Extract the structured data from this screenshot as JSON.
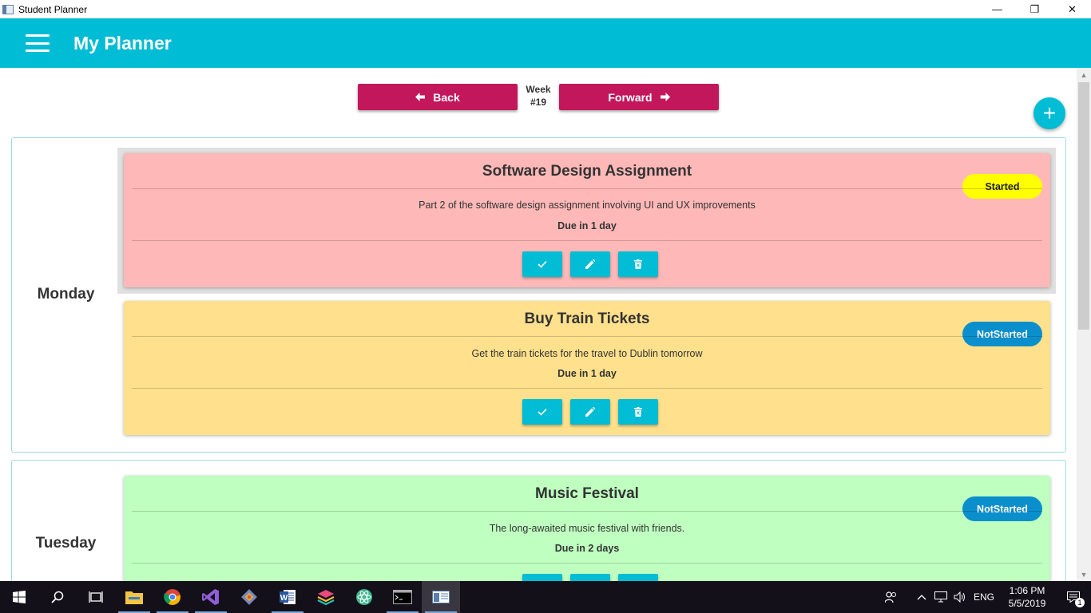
{
  "window": {
    "title": "Student Planner",
    "minimize": "—",
    "maximize": "❐",
    "close": "✕"
  },
  "header": {
    "title": "My Planner"
  },
  "nav": {
    "back_label": "Back",
    "forward_label": "Forward",
    "week_label": "Week",
    "week_number": "#19",
    "add_label": "+"
  },
  "days": [
    {
      "name": "Monday",
      "tasks": [
        {
          "title": "Software Design Assignment",
          "description": "Part 2 of the software design assignment involving UI and UX improvements",
          "due": "Due in 1 day",
          "status": "Started",
          "color": "#ffb8b8",
          "selected": true
        },
        {
          "title": "Buy Train Tickets",
          "description": "Get the train tickets for the travel to Dublin tomorrow",
          "due": "Due in 1 day",
          "status": "NotStarted",
          "color": "#ffe08c"
        }
      ]
    },
    {
      "name": "Tuesday",
      "tasks": [
        {
          "title": "Music Festival",
          "description": "The long-awaited music festival with friends.",
          "due": "Due in 2 days",
          "status": "NotStarted",
          "color": "#bfffc0"
        }
      ]
    }
  ],
  "taskbar": {
    "apps": [
      "windows-start",
      "search",
      "task-view",
      "file-explorer",
      "chrome",
      "visual-studio",
      "git",
      "word",
      "stack-app",
      "atom",
      "terminal",
      "student-planner"
    ],
    "language": "ENG",
    "time": "1:06 PM",
    "date": "5/5/2019",
    "notification_count": "1"
  },
  "colors": {
    "accent": "#00bcd4",
    "nav_button": "#c2185b"
  }
}
